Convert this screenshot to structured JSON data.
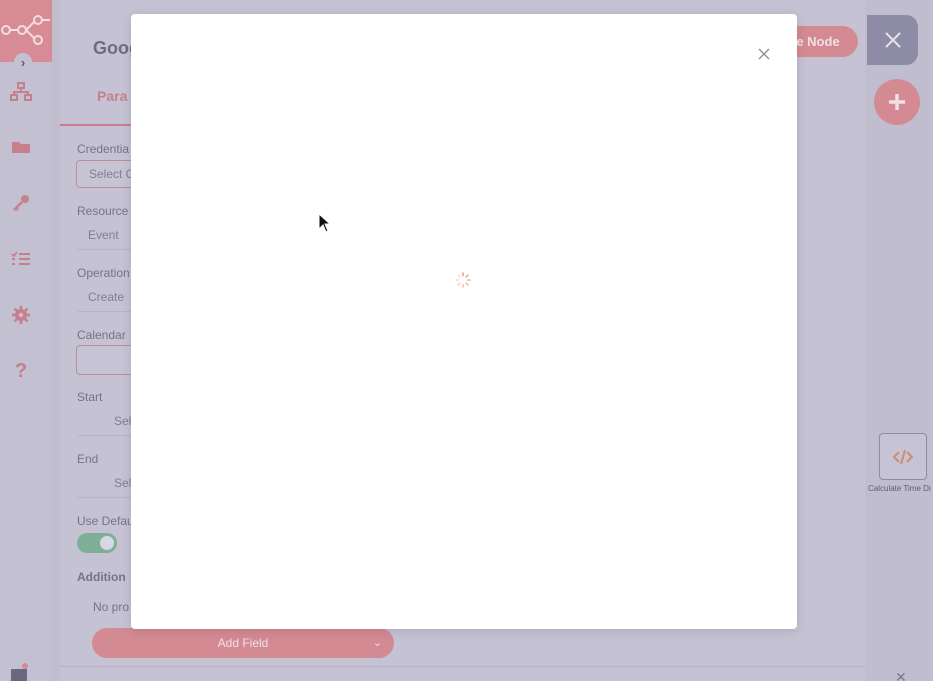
{
  "sidebar": {
    "items": [
      {
        "icon": "workflow-icon"
      },
      {
        "icon": "templates-icon"
      },
      {
        "icon": "credentials-icon"
      },
      {
        "icon": "executions-icon"
      },
      {
        "icon": "settings-icon"
      },
      {
        "icon": "help-icon"
      }
    ]
  },
  "node_panel": {
    "title": "Goog",
    "tab_label": "Para",
    "execute_label": "te Node",
    "fields": {
      "credential_label": "Credentia",
      "credential_value": "Select C",
      "resource_label": "Resource",
      "resource_value": "Event",
      "operation_label": "Operation",
      "operation_value": "Create",
      "calendar_label": "Calendar",
      "start_label": "Start",
      "start_value": "Sel",
      "end_label": "End",
      "end_value": "Sel",
      "use_default_label": "Use Defau",
      "use_default_on": true,
      "additional_label": "Addition",
      "no_props": "No pro"
    },
    "add_field_label": "Add Field"
  },
  "canvas": {
    "node_label": "Calculate Time Di"
  },
  "colors": {
    "accent": "#d48a93",
    "overlay": "#bfbdce",
    "modal_bg": "#ffffff",
    "spinner": "#f0a070"
  }
}
